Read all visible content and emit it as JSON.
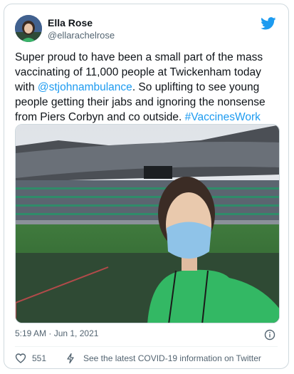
{
  "author": {
    "display_name": "Ella Rose",
    "handle": "@ellarachelrose"
  },
  "tweet": {
    "text_1": "Super proud to have been a small part of the mass vaccinating of 11,000 people at Twickenham today with ",
    "mention": "@stjohnambulance",
    "text_2": ". So uplifting to see young people getting their jabs and ignoring the nonsense from Piers Corbyn and co outside. ",
    "hashtag": "#VaccinesWork"
  },
  "meta": {
    "timestamp": "5:19 AM · Jun 1, 2021"
  },
  "actions": {
    "like_count": "551",
    "covid_link": "See the latest COVID-19 information on Twitter"
  },
  "icons": {
    "brand": "twitter-bird-icon",
    "info": "info-icon",
    "like": "heart-icon",
    "covid": "covid-info-icon"
  },
  "colors": {
    "link": "#1d9bf0",
    "secondary_text": "#536471",
    "border": "#cfd9de"
  }
}
